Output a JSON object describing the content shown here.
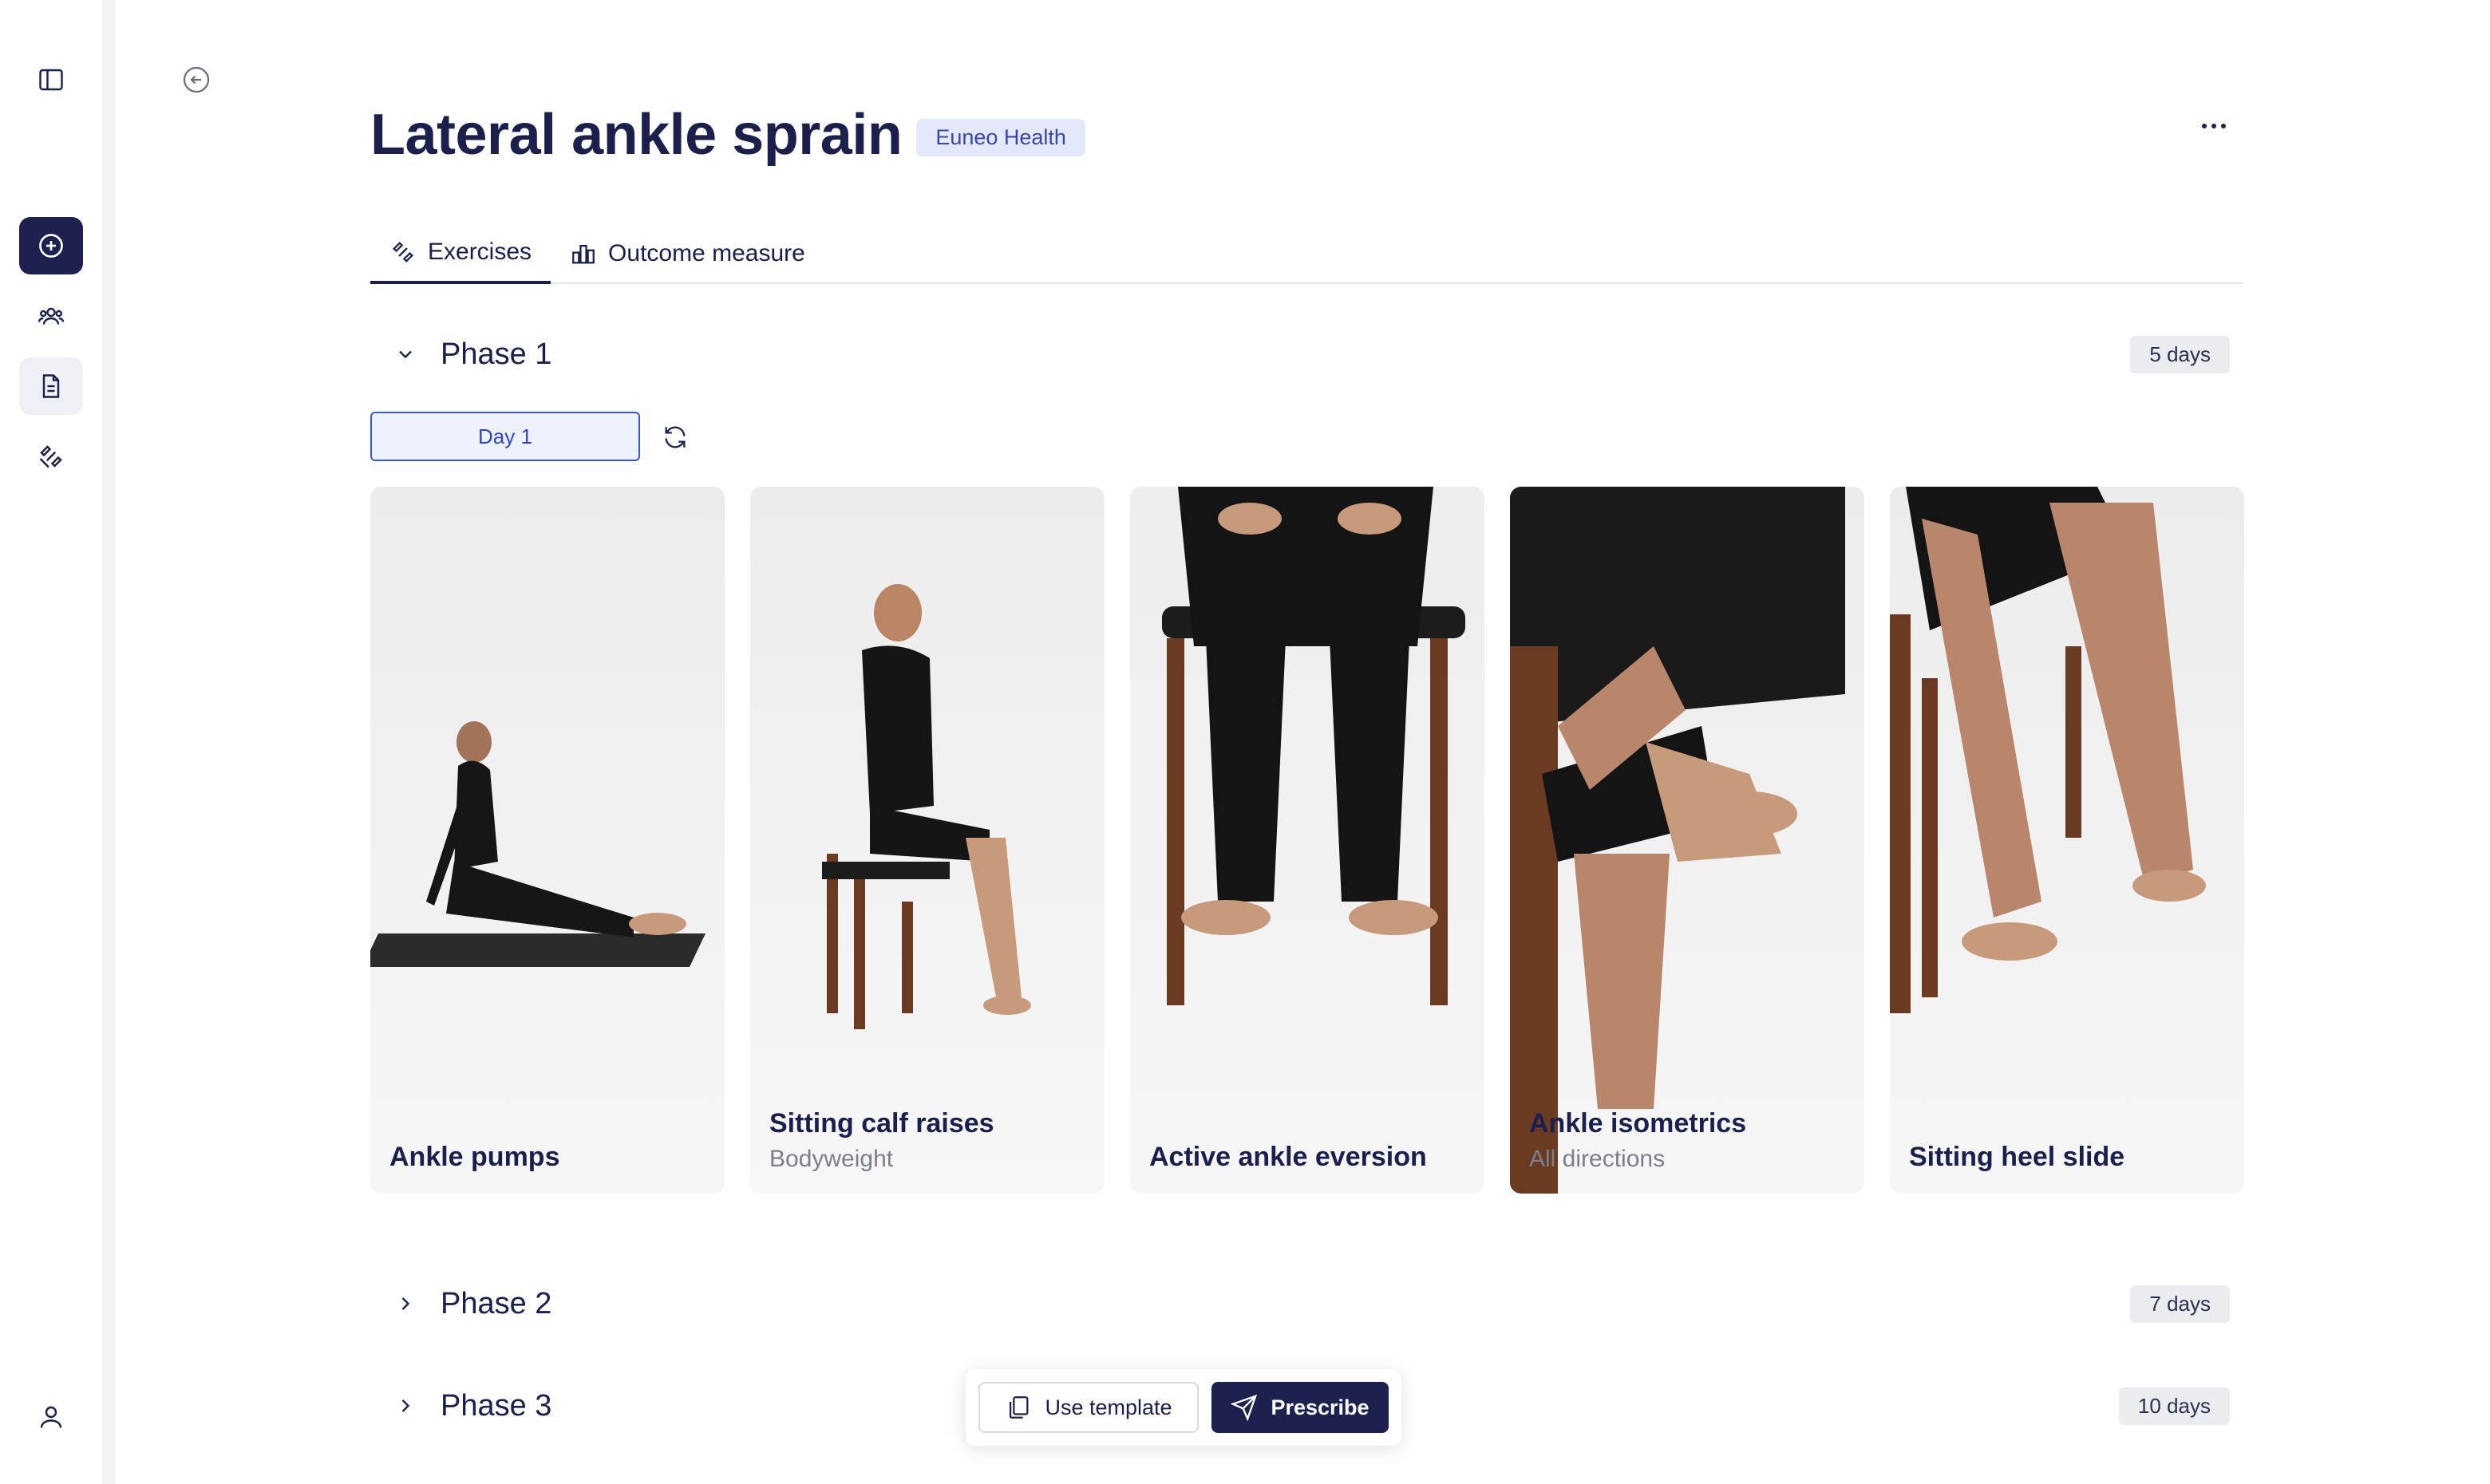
{
  "page": {
    "title": "Lateral ankle sprain",
    "org_badge": "Euneo Health"
  },
  "tabs": [
    {
      "label": "Exercises",
      "icon": "dumbbell-icon",
      "active": true
    },
    {
      "label": "Outcome measure",
      "icon": "bar-chart-icon",
      "active": false
    }
  ],
  "phases": [
    {
      "title": "Phase 1",
      "days": "5 days",
      "expanded": true
    },
    {
      "title": "Phase 2",
      "days": "7 days",
      "expanded": false
    },
    {
      "title": "Phase 3",
      "days": "10 days",
      "expanded": false
    }
  ],
  "day_selector": {
    "value": "Day 1"
  },
  "exercises": [
    {
      "title": "Ankle pumps",
      "subtitle": ""
    },
    {
      "title": "Sitting calf raises",
      "subtitle": "Bodyweight"
    },
    {
      "title": "Active ankle eversion",
      "subtitle": ""
    },
    {
      "title": "Ankle isometrics",
      "subtitle": "All directions"
    },
    {
      "title": "Sitting heel slide",
      "subtitle": ""
    }
  ],
  "actions": {
    "use_template": "Use template",
    "prescribe": "Prescribe"
  },
  "colors": {
    "primary": "#1d2150",
    "badge_bg": "#e3e8fb",
    "badge_text": "#3a47a8",
    "accent_blue": "#3a57d8"
  }
}
